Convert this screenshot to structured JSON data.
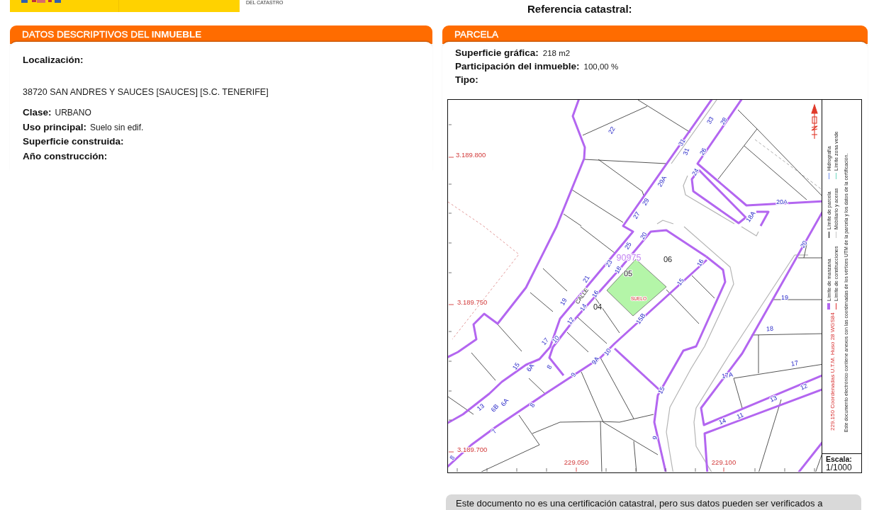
{
  "header": {
    "agency_subtitle": "DEL CATASTRO",
    "reference_label": "Referencia catastral:"
  },
  "descriptive_panel": {
    "title": "DATOS DESCRIPTIVOS DEL **INMUEBLE**",
    "location_label": "Localización:",
    "address": "38720 SAN ANDRES Y SAUCES [SAUCES] [S.C. TENERIFE]",
    "fields": [
      {
        "label": "Clase:",
        "value": "URBANO"
      },
      {
        "label": "Uso principal:",
        "value": "Suelo sin edif."
      },
      {
        "label": "Superficie construida:"
      },
      {
        "label": "Año construcción:"
      }
    ]
  },
  "parcel_panel": {
    "title": "PARCELA",
    "fields": [
      {
        "label": "Superficie gráfica:",
        "value": "218 m2"
      },
      {
        "label": "Participación del inmueble:",
        "value": "100,00 %"
      },
      {
        "label": "Tipo:"
      }
    ],
    "map": {
      "labels": [
        {
          "kind": "coordinate",
          "text": "3.189.800"
        },
        {
          "kind": "coordinate",
          "text": "3.189.750"
        },
        {
          "kind": "coordinate",
          "text": "3.189.700"
        },
        {
          "kind": "coordinate",
          "text": "229.050"
        },
        {
          "kind": "coordinate",
          "text": "229.100"
        },
        {
          "kind": "street_number",
          "text": "22"
        },
        {
          "kind": "street_number",
          "text": "33"
        },
        {
          "kind": "street_number",
          "text": "28"
        },
        {
          "kind": "street_number",
          "text": "31"
        },
        {
          "kind": "street_number",
          "text": "31"
        },
        {
          "kind": "street_number",
          "text": "26"
        },
        {
          "kind": "street_number",
          "text": "24"
        },
        {
          "kind": "street_number",
          "text": "29A"
        },
        {
          "kind": "street_number",
          "text": "29"
        },
        {
          "kind": "street_number",
          "text": "27"
        },
        {
          "kind": "street_number",
          "text": "20A"
        },
        {
          "kind": "street_number",
          "text": "18A"
        },
        {
          "kind": "street_number",
          "text": "20"
        },
        {
          "kind": "street_number",
          "text": "25"
        },
        {
          "kind": "street_number",
          "text": "23"
        },
        {
          "kind": "street_number",
          "text": "18"
        },
        {
          "kind": "street_number",
          "text": "21"
        },
        {
          "kind": "street_number",
          "text": "16"
        },
        {
          "kind": "street_number",
          "text": "19"
        },
        {
          "kind": "street_number",
          "text": "14"
        },
        {
          "kind": "street_number",
          "text": "12"
        },
        {
          "kind": "street_number",
          "text": "10"
        },
        {
          "kind": "street_number",
          "text": "17"
        },
        {
          "kind": "street_number",
          "text": "15"
        },
        {
          "kind": "street_number",
          "text": "6A"
        },
        {
          "kind": "street_number",
          "text": "8"
        },
        {
          "kind": "street_number",
          "text": "9"
        },
        {
          "kind": "street_number",
          "text": "9A"
        },
        {
          "kind": "street_number",
          "text": "10"
        },
        {
          "kind": "street_number",
          "text": "15B"
        },
        {
          "kind": "street_number",
          "text": "15"
        },
        {
          "kind": "street_number",
          "text": "16"
        },
        {
          "kind": "street_number",
          "text": "20"
        },
        {
          "kind": "street_number",
          "text": "19"
        },
        {
          "kind": "street_number",
          "text": "18"
        },
        {
          "kind": "street_number",
          "text": "17"
        },
        {
          "kind": "street_number",
          "text": "17A"
        },
        {
          "kind": "street_number",
          "text": "13"
        },
        {
          "kind": "street_number",
          "text": "12"
        },
        {
          "kind": "street_number",
          "text": "14"
        },
        {
          "kind": "street_number",
          "text": "11"
        },
        {
          "kind": "street_number",
          "text": "13"
        },
        {
          "kind": "street_number",
          "text": "6B"
        },
        {
          "kind": "street_number",
          "text": "6A"
        },
        {
          "kind": "street_number",
          "text": "8"
        },
        {
          "kind": "street_number",
          "text": "7"
        },
        {
          "kind": "street_number",
          "text": "15"
        },
        {
          "kind": "street_number",
          "text": "9"
        },
        {
          "kind": "block_number",
          "text": "90975"
        },
        {
          "kind": "parcel_number",
          "text": "05"
        },
        {
          "kind": "parcel_number",
          "text": "06"
        },
        {
          "kind": "parcel_number",
          "text": "04"
        },
        {
          "kind": "land_use",
          "text": "SUELO"
        },
        {
          "kind": "street_name",
          "text": "CALLE"
        },
        {
          "kind": "street_number",
          "text": "8"
        }
      ],
      "legend": [
        {
          "kind": "band",
          "label": "Límite de manzana",
          "color": "#b366f0"
        },
        {
          "kind": "line",
          "label": "Límite de construcciones",
          "color": "#e03030"
        },
        {
          "kind": "line",
          "label": "Límite de parcela",
          "color": "#000000"
        },
        {
          "kind": "line",
          "label": "Mobiliario y aceras",
          "color": "#c8c8c8"
        },
        {
          "kind": "line",
          "label": "Hidrografía",
          "color": "#6e8ef0"
        },
        {
          "kind": "line",
          "label": "Límite zona verde",
          "color": "#6ed8c0"
        }
      ],
      "coordinate_note": "229.150 Coordenadas U.T.M. Huso 28 WGS84",
      "annex_note": "Este documento electrónico contiene anexos con las coordenadas de los vértices UTM de la parcela y los datos de la certificación.",
      "scale_label": "Escala:",
      "scale": "1/1000"
    }
  },
  "notice": {
    "text": "Este documento no es una certificación catastral, pero sus datos pueden ser verificados a"
  }
}
